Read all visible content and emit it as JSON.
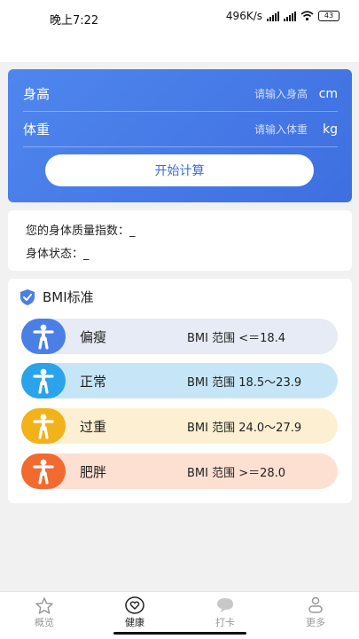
{
  "status_bar": {
    "time": "晚上7:22",
    "speed": "496K/s",
    "battery": "43"
  },
  "calculator": {
    "height_label": "身高",
    "height_placeholder": "请输入身高",
    "height_unit": "cm",
    "weight_label": "体重",
    "weight_placeholder": "请输入体重",
    "weight_unit": "kg",
    "start_button": "开始计算"
  },
  "result": {
    "bmi_line": "您的身体质量指数：_",
    "status_line": "身体状态：_"
  },
  "standard": {
    "title": "BMI标准",
    "rows": [
      {
        "name": "偏瘦",
        "range": "BMI 范围 <＝18.4",
        "icon_color": "#4a7fe6",
        "bg_color": "#e6ebf5",
        "icon": "person-arms-out-icon"
      },
      {
        "name": "正常",
        "range": "BMI 范围 18.5～23.9",
        "icon_color": "#2aa3ea",
        "bg_color": "#c6e6f8",
        "icon": "person-arms-out-icon"
      },
      {
        "name": "过重",
        "range": "BMI 范围 24.0～27.9",
        "icon_color": "#f1b21a",
        "bg_color": "#fcefd2",
        "icon": "person-arms-out-icon"
      },
      {
        "name": "肥胖",
        "range": "BMI 范围 >＝28.0",
        "icon_color": "#f26a2f",
        "bg_color": "#fde0d2",
        "icon": "person-arms-out-icon"
      }
    ]
  },
  "tabbar": {
    "tabs": [
      {
        "label": "概览",
        "icon": "star-icon",
        "active": false
      },
      {
        "label": "健康",
        "icon": "heart-icon",
        "active": true
      },
      {
        "label": "打卡",
        "icon": "chat-bubble-icon",
        "active": false
      },
      {
        "label": "更多",
        "icon": "person-icon",
        "active": false
      }
    ]
  },
  "colors": {
    "primary": "#4a7fe6",
    "background": "#f1f1f1"
  }
}
